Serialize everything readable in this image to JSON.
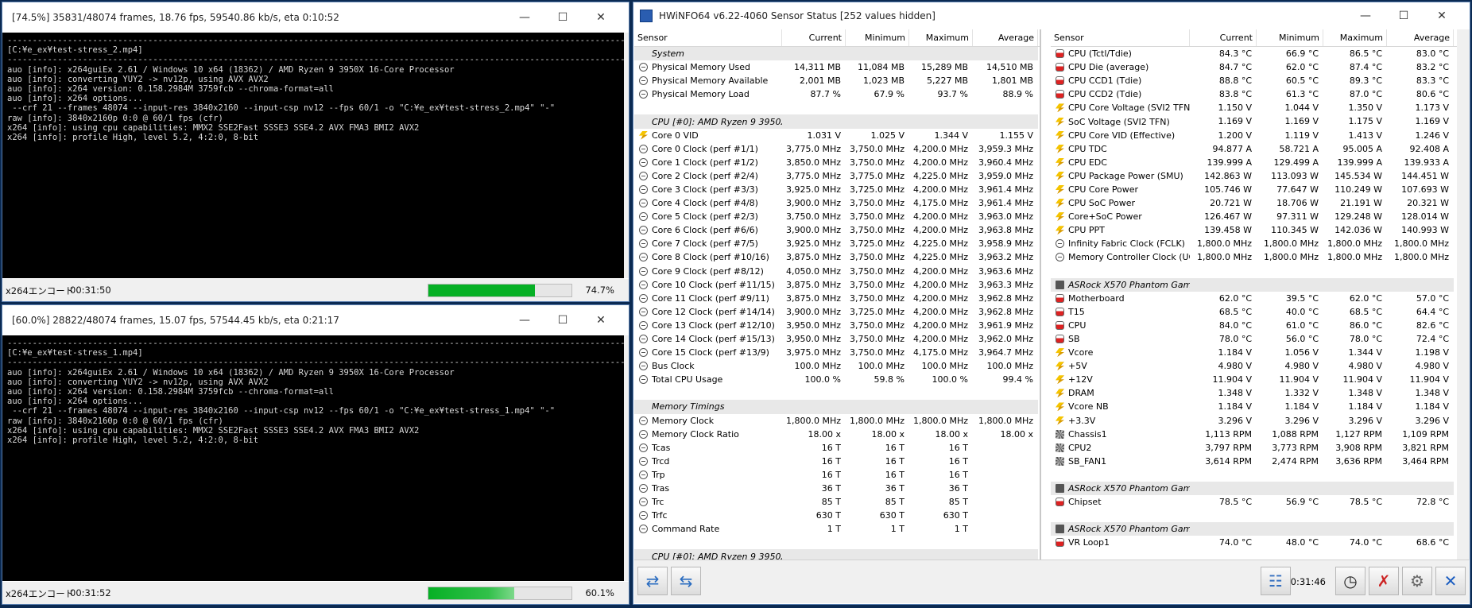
{
  "colors": {
    "console_bg": "#000000",
    "console_fg": "#d7d7d7",
    "progress": "#06b025",
    "group_bg": "#e8e8e8"
  },
  "console1": {
    "title": "[74.5%] 35831/48074 frames, 18.76 fps, 59540.86 kb/s, eta 0:10:52",
    "lines": [
      "-------------------------------------------------------------------------------------------------------------------------------------",
      "[C:¥e_ex¥test-stress_2.mp4]",
      "-------------------------------------------------------------------------------------------------------------------------------------",
      "auo [info]: x264guiEx 2.61 / Windows 10 x64 (18362) / AMD Ryzen 9 3950X 16-Core Processor",
      "auo [info]: converting YUY2 -> nv12p, using AVX AVX2",
      "auo [info]: x264 version: 0.158.2984M 3759fcb --chroma-format=all",
      "auo [info]: x264 options...",
      " --crf 21 --frames 48074 --input-res 3840x2160 --input-csp nv12 --fps 60/1 -o \"C:¥e_ex¥test-stress_2.mp4\" \"-\"",
      "raw [info]: 3840x2160p 0:0 @ 60/1 fps (cfr)",
      "x264 [info]: using cpu capabilities: MMX2 SSE2Fast SSSE3 SSE4.2 AVX FMA3 BMI2 AVX2",
      "x264 [info]: profile High, level 5.2, 4:2:0, 8-bit"
    ],
    "status_label": "x264エンコード",
    "elapsed": "00:31:50",
    "progress": 0.745,
    "percent": "74.7%"
  },
  "console2": {
    "title": "[60.0%] 28822/48074 frames, 15.07 fps, 57544.45 kb/s, eta 0:21:17",
    "lines": [
      "-------------------------------------------------------------------------------------------------------------------------------------",
      "[C:¥e_ex¥test-stress_1.mp4]",
      "-------------------------------------------------------------------------------------------------------------------------------------",
      "auo [info]: x264guiEx 2.61 / Windows 10 x64 (18362) / AMD Ryzen 9 3950X 16-Core Processor",
      "auo [info]: converting YUY2 -> nv12p, using AVX AVX2",
      "auo [info]: x264 version: 0.158.2984M 3759fcb --chroma-format=all",
      "auo [info]: x264 options...",
      " --crf 21 --frames 48074 --input-res 3840x2160 --input-csp nv12 --fps 60/1 -o \"C:¥e_ex¥test-stress_1.mp4\" \"-\"",
      "raw [info]: 3840x2160p 0:0 @ 60/1 fps (cfr)",
      "x264 [info]: using cpu capabilities: MMX2 SSE2Fast SSSE3 SSE4.2 AVX FMA3 BMI2 AVX2",
      "x264 [info]: profile High, level 5.2, 4:2:0, 8-bit"
    ],
    "status_label": "x264エンコード",
    "elapsed": "00:31:52",
    "progress": 0.6,
    "percent": "60.1%"
  },
  "hwinfo": {
    "title": "HWiNFO64 v6.22-4060 Sensor Status [252 values hidden]",
    "columns": [
      "Sensor",
      "Current",
      "Minimum",
      "Maximum",
      "Average"
    ],
    "elapsed": "0:31:46",
    "left_rows": [
      {
        "t": "group",
        "name": "System"
      },
      {
        "i": "circ",
        "name": "Physical Memory Used",
        "v": [
          "14,311 MB",
          "11,084 MB",
          "15,289 MB",
          "14,510 MB"
        ]
      },
      {
        "i": "circ",
        "name": "Physical Memory Available",
        "v": [
          "2,001 MB",
          "1,023 MB",
          "5,227 MB",
          "1,801 MB"
        ]
      },
      {
        "i": "circ",
        "name": "Physical Memory Load",
        "v": [
          "87.7 %",
          "67.9 %",
          "93.7 %",
          "88.9 %"
        ]
      },
      {
        "t": "blank"
      },
      {
        "t": "group",
        "name": "CPU [#0]: AMD Ryzen 9 3950X"
      },
      {
        "i": "bolt",
        "name": "Core 0 VID",
        "v": [
          "1.031 V",
          "1.025 V",
          "1.344 V",
          "1.155 V"
        ]
      },
      {
        "i": "circ",
        "name": "Core 0 Clock (perf #1/1)",
        "v": [
          "3,775.0 MHz",
          "3,750.0 MHz",
          "4,200.0 MHz",
          "3,959.3 MHz"
        ]
      },
      {
        "i": "circ",
        "name": "Core 1 Clock (perf #1/2)",
        "v": [
          "3,850.0 MHz",
          "3,750.0 MHz",
          "4,200.0 MHz",
          "3,960.4 MHz"
        ]
      },
      {
        "i": "circ",
        "name": "Core 2 Clock (perf #2/4)",
        "v": [
          "3,775.0 MHz",
          "3,775.0 MHz",
          "4,225.0 MHz",
          "3,959.0 MHz"
        ]
      },
      {
        "i": "circ",
        "name": "Core 3 Clock (perf #3/3)",
        "v": [
          "3,925.0 MHz",
          "3,725.0 MHz",
          "4,200.0 MHz",
          "3,961.4 MHz"
        ]
      },
      {
        "i": "circ",
        "name": "Core 4 Clock (perf #4/8)",
        "v": [
          "3,900.0 MHz",
          "3,750.0 MHz",
          "4,175.0 MHz",
          "3,961.4 MHz"
        ]
      },
      {
        "i": "circ",
        "name": "Core 5 Clock (perf #2/3)",
        "v": [
          "3,750.0 MHz",
          "3,750.0 MHz",
          "4,200.0 MHz",
          "3,963.0 MHz"
        ]
      },
      {
        "i": "circ",
        "name": "Core 6 Clock (perf #6/6)",
        "v": [
          "3,900.0 MHz",
          "3,750.0 MHz",
          "4,200.0 MHz",
          "3,963.8 MHz"
        ]
      },
      {
        "i": "circ",
        "name": "Core 7 Clock (perf #7/5)",
        "v": [
          "3,925.0 MHz",
          "3,725.0 MHz",
          "4,225.0 MHz",
          "3,958.9 MHz"
        ]
      },
      {
        "i": "circ",
        "name": "Core 8 Clock (perf #10/16)",
        "v": [
          "3,875.0 MHz",
          "3,750.0 MHz",
          "4,225.0 MHz",
          "3,963.2 MHz"
        ]
      },
      {
        "i": "circ",
        "name": "Core 9 Clock (perf #8/12)",
        "v": [
          "4,050.0 MHz",
          "3,750.0 MHz",
          "4,200.0 MHz",
          "3,963.6 MHz"
        ]
      },
      {
        "i": "circ",
        "name": "Core 10 Clock (perf #11/15)",
        "v": [
          "3,875.0 MHz",
          "3,750.0 MHz",
          "4,200.0 MHz",
          "3,963.3 MHz"
        ]
      },
      {
        "i": "circ",
        "name": "Core 11 Clock (perf #9/11)",
        "v": [
          "3,875.0 MHz",
          "3,750.0 MHz",
          "4,200.0 MHz",
          "3,962.8 MHz"
        ]
      },
      {
        "i": "circ",
        "name": "Core 12 Clock (perf #14/14)",
        "v": [
          "3,900.0 MHz",
          "3,725.0 MHz",
          "4,200.0 MHz",
          "3,962.8 MHz"
        ]
      },
      {
        "i": "circ",
        "name": "Core 13 Clock (perf #12/10)",
        "v": [
          "3,950.0 MHz",
          "3,750.0 MHz",
          "4,200.0 MHz",
          "3,961.9 MHz"
        ]
      },
      {
        "i": "circ",
        "name": "Core 14 Clock (perf #15/13)",
        "v": [
          "3,950.0 MHz",
          "3,750.0 MHz",
          "4,200.0 MHz",
          "3,962.0 MHz"
        ]
      },
      {
        "i": "circ",
        "name": "Core 15 Clock (perf #13/9)",
        "v": [
          "3,975.0 MHz",
          "3,750.0 MHz",
          "4,175.0 MHz",
          "3,964.7 MHz"
        ]
      },
      {
        "i": "circ",
        "name": "Bus Clock",
        "v": [
          "100.0 MHz",
          "100.0 MHz",
          "100.0 MHz",
          "100.0 MHz"
        ]
      },
      {
        "i": "circ",
        "name": "Total CPU Usage",
        "v": [
          "100.0 %",
          "59.8 %",
          "100.0 %",
          "99.4 %"
        ]
      },
      {
        "t": "blank"
      },
      {
        "t": "group",
        "name": "Memory Timings"
      },
      {
        "i": "circ",
        "name": "Memory Clock",
        "v": [
          "1,800.0 MHz",
          "1,800.0 MHz",
          "1,800.0 MHz",
          "1,800.0 MHz"
        ]
      },
      {
        "i": "circ",
        "name": "Memory Clock Ratio",
        "v": [
          "18.00 x",
          "18.00 x",
          "18.00 x",
          "18.00 x"
        ]
      },
      {
        "i": "circ",
        "name": "Tcas",
        "v": [
          "16 T",
          "16 T",
          "16 T",
          ""
        ]
      },
      {
        "i": "circ",
        "name": "Trcd",
        "v": [
          "16 T",
          "16 T",
          "16 T",
          ""
        ]
      },
      {
        "i": "circ",
        "name": "Trp",
        "v": [
          "16 T",
          "16 T",
          "16 T",
          ""
        ]
      },
      {
        "i": "circ",
        "name": "Tras",
        "v": [
          "36 T",
          "36 T",
          "36 T",
          ""
        ]
      },
      {
        "i": "circ",
        "name": "Trc",
        "v": [
          "85 T",
          "85 T",
          "85 T",
          ""
        ]
      },
      {
        "i": "circ",
        "name": "Trfc",
        "v": [
          "630 T",
          "630 T",
          "630 T",
          ""
        ]
      },
      {
        "i": "circ",
        "name": "Command Rate",
        "v": [
          "1 T",
          "1 T",
          "1 T",
          ""
        ]
      },
      {
        "t": "blank"
      },
      {
        "t": "group",
        "name": "CPU [#0]: AMD Ryzen 9 3950X..."
      }
    ],
    "right_rows": [
      {
        "i": "therm",
        "name": "CPU (Tctl/Tdie)",
        "v": [
          "84.3 °C",
          "66.9 °C",
          "86.5 °C",
          "83.0 °C"
        ]
      },
      {
        "i": "therm",
        "name": "CPU Die (average)",
        "v": [
          "84.7 °C",
          "62.0 °C",
          "87.4 °C",
          "83.2 °C"
        ]
      },
      {
        "i": "therm",
        "name": "CPU CCD1 (Tdie)",
        "v": [
          "88.8 °C",
          "60.5 °C",
          "89.3 °C",
          "83.3 °C"
        ]
      },
      {
        "i": "therm",
        "name": "CPU CCD2 (Tdie)",
        "v": [
          "83.8 °C",
          "61.3 °C",
          "87.0 °C",
          "80.6 °C"
        ]
      },
      {
        "i": "bolt",
        "name": "CPU Core Voltage (SVI2 TFN)",
        "v": [
          "1.150 V",
          "1.044 V",
          "1.350 V",
          "1.173 V"
        ]
      },
      {
        "i": "bolt",
        "name": "SoC Voltage (SVI2 TFN)",
        "v": [
          "1.169 V",
          "1.169 V",
          "1.175 V",
          "1.169 V"
        ]
      },
      {
        "i": "bolt",
        "name": "CPU Core VID (Effective)",
        "v": [
          "1.200 V",
          "1.119 V",
          "1.413 V",
          "1.246 V"
        ]
      },
      {
        "i": "bolt",
        "name": "CPU TDC",
        "v": [
          "94.877 A",
          "58.721 A",
          "95.005 A",
          "92.408 A"
        ]
      },
      {
        "i": "bolt",
        "name": "CPU EDC",
        "v": [
          "139.999 A",
          "129.499 A",
          "139.999 A",
          "139.933 A"
        ]
      },
      {
        "i": "bolt",
        "name": "CPU Package Power (SMU)",
        "v": [
          "142.863 W",
          "113.093 W",
          "145.534 W",
          "144.451 W"
        ]
      },
      {
        "i": "bolt",
        "name": "CPU Core Power",
        "v": [
          "105.746 W",
          "77.647 W",
          "110.249 W",
          "107.693 W"
        ]
      },
      {
        "i": "bolt",
        "name": "CPU SoC Power",
        "v": [
          "20.721 W",
          "18.706 W",
          "21.191 W",
          "20.321 W"
        ]
      },
      {
        "i": "bolt",
        "name": "Core+SoC Power",
        "v": [
          "126.467 W",
          "97.311 W",
          "129.248 W",
          "128.014 W"
        ]
      },
      {
        "i": "bolt",
        "name": "CPU PPT",
        "v": [
          "139.458 W",
          "110.345 W",
          "142.036 W",
          "140.993 W"
        ]
      },
      {
        "i": "circ",
        "name": "Infinity Fabric Clock (FCLK)",
        "v": [
          "1,800.0 MHz",
          "1,800.0 MHz",
          "1,800.0 MHz",
          "1,800.0 MHz"
        ]
      },
      {
        "i": "circ",
        "name": "Memory Controller Clock (UC...",
        "v": [
          "1,800.0 MHz",
          "1,800.0 MHz",
          "1,800.0 MHz",
          "1,800.0 MHz"
        ]
      },
      {
        "t": "blank"
      },
      {
        "t": "group",
        "i": "chip",
        "name": "ASRock X570 Phantom Gami..."
      },
      {
        "i": "therm",
        "name": "Motherboard",
        "v": [
          "62.0 °C",
          "39.5 °C",
          "62.0 °C",
          "57.0 °C"
        ]
      },
      {
        "i": "therm",
        "name": "T15",
        "v": [
          "68.5 °C",
          "40.0 °C",
          "68.5 °C",
          "64.4 °C"
        ]
      },
      {
        "i": "therm",
        "name": "CPU",
        "v": [
          "84.0 °C",
          "61.0 °C",
          "86.0 °C",
          "82.6 °C"
        ]
      },
      {
        "i": "therm",
        "name": "SB",
        "v": [
          "78.0 °C",
          "56.0 °C",
          "78.0 °C",
          "72.4 °C"
        ]
      },
      {
        "i": "bolt",
        "name": "Vcore",
        "v": [
          "1.184 V",
          "1.056 V",
          "1.344 V",
          "1.198 V"
        ]
      },
      {
        "i": "bolt",
        "name": "+5V",
        "v": [
          "4.980 V",
          "4.980 V",
          "4.980 V",
          "4.980 V"
        ]
      },
      {
        "i": "bolt",
        "name": "+12V",
        "v": [
          "11.904 V",
          "11.904 V",
          "11.904 V",
          "11.904 V"
        ]
      },
      {
        "i": "bolt",
        "name": "DRAM",
        "v": [
          "1.348 V",
          "1.332 V",
          "1.348 V",
          "1.348 V"
        ]
      },
      {
        "i": "bolt",
        "name": "Vcore NB",
        "v": [
          "1.184 V",
          "1.184 V",
          "1.184 V",
          "1.184 V"
        ]
      },
      {
        "i": "bolt",
        "name": "+3.3V",
        "v": [
          "3.296 V",
          "3.296 V",
          "3.296 V",
          "3.296 V"
        ]
      },
      {
        "i": "fan",
        "name": "Chassis1",
        "v": [
          "1,113 RPM",
          "1,088 RPM",
          "1,127 RPM",
          "1,109 RPM"
        ]
      },
      {
        "i": "fan",
        "name": "CPU2",
        "v": [
          "3,797 RPM",
          "3,773 RPM",
          "3,908 RPM",
          "3,821 RPM"
        ]
      },
      {
        "i": "fan",
        "name": "SB_FAN1",
        "v": [
          "3,614 RPM",
          "2,474 RPM",
          "3,636 RPM",
          "3,464 RPM"
        ]
      },
      {
        "t": "blank"
      },
      {
        "t": "group",
        "i": "chip",
        "name": "ASRock X570 Phantom Gami..."
      },
      {
        "i": "therm",
        "name": "Chipset",
        "v": [
          "78.5 °C",
          "56.9 °C",
          "78.5 °C",
          "72.8 °C"
        ]
      },
      {
        "t": "blank"
      },
      {
        "t": "group",
        "i": "chip",
        "name": "ASRock X570 Phantom Gami..."
      },
      {
        "i": "therm",
        "name": "VR Loop1",
        "v": [
          "74.0 °C",
          "48.0 °C",
          "74.0 °C",
          "68.6 °C"
        ]
      }
    ]
  }
}
